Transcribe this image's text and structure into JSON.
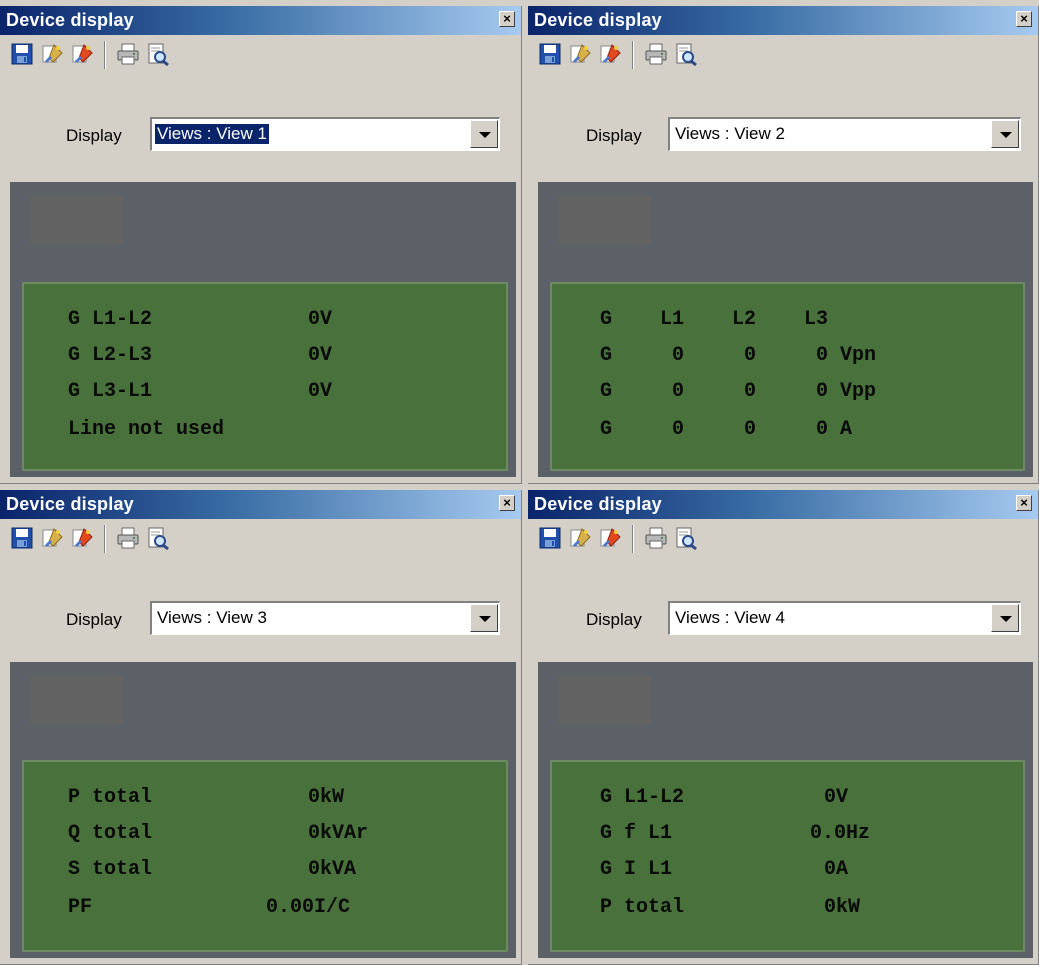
{
  "panels": [
    {
      "title": "Device display",
      "display_label": "Display",
      "selected_view": "Views : View 1",
      "lcd_lines": [
        {
          "left": "G L1-L2",
          "right": "0V"
        },
        {
          "left": "G L2-L3",
          "right": "0V"
        },
        {
          "left": "G L3-L1",
          "right": "0V"
        },
        {
          "left": "Line not used",
          "right": ""
        }
      ]
    },
    {
      "title": "Device display",
      "display_label": "Display",
      "selected_view": "Views : View 2",
      "lcd_lines": [
        {
          "text": "G    L1    L2    L3"
        },
        {
          "text": "G     0     0     0 Vpn"
        },
        {
          "text": "G     0     0     0 Vpp"
        },
        {
          "text": "G     0     0     0 A"
        }
      ]
    },
    {
      "title": "Device display",
      "display_label": "Display",
      "selected_view": "Views : View 3",
      "lcd_lines": [
        {
          "left": "P total",
          "right": "0kW"
        },
        {
          "left": "Q total",
          "right": "0kVAr"
        },
        {
          "left": "S total",
          "right": "0kVA"
        },
        {
          "left": "PF",
          "right": "0.00I/C"
        }
      ]
    },
    {
      "title": "Device display",
      "display_label": "Display",
      "selected_view": "Views : View 4",
      "lcd_lines": [
        {
          "left": "G L1-L2",
          "right": "0V"
        },
        {
          "left": "G f L1",
          "right": "0.0Hz"
        },
        {
          "left": "G I L1",
          "right": "0A"
        },
        {
          "left": "P total",
          "right": "0kW"
        }
      ]
    }
  ],
  "icons": {
    "close": "close-icon",
    "save": "save-icon",
    "wizard1": "edit-wizard-icon",
    "wizard2": "edit-wizard-red-icon",
    "print": "print-icon",
    "preview": "print-preview-icon"
  },
  "close_glyph": "×",
  "colors": {
    "title_gradient_start": "#0a246a",
    "title_gradient_end": "#a6caf0",
    "window_bg": "#d4d0c8",
    "display_bg": "#5b6166",
    "lcd_bg": "#49713b",
    "lcd_text": "#0a0a0a"
  }
}
